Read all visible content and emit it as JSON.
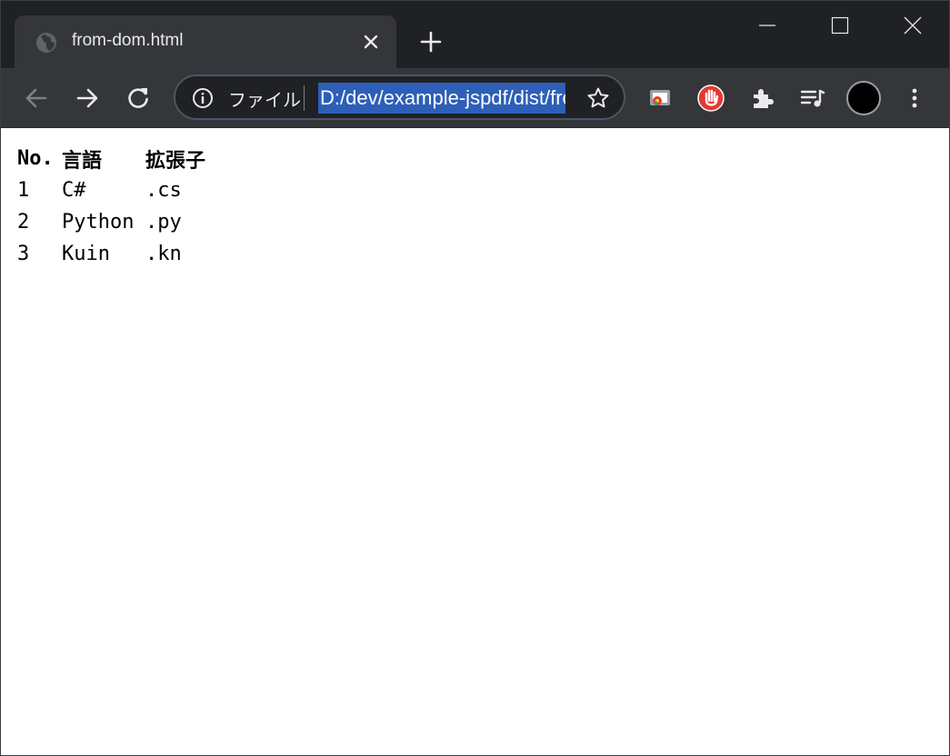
{
  "tab": {
    "title": "from-dom.html"
  },
  "omnibox": {
    "scheme_label": "ファイル",
    "url": "D:/dev/example-jspdf/dist/from-dom.html"
  },
  "table": {
    "headers": [
      "No.",
      "言語",
      "拡張子"
    ],
    "rows": [
      [
        "1",
        "C#",
        ".cs"
      ],
      [
        "2",
        "Python",
        ".py"
      ],
      [
        "3",
        "Kuin",
        ".kn"
      ]
    ]
  },
  "colors": {
    "titlebar": "#202124",
    "toolbar": "#35363a",
    "selection": "#2d5fb8"
  },
  "icons": {
    "favicon": "globe-icon",
    "tab_close": "close-icon",
    "new_tab": "plus-icon",
    "back": "arrow-left-icon",
    "forward": "arrow-right-icon",
    "reload": "reload-icon",
    "info": "info-icon",
    "bookmark": "star-icon",
    "cast": "cast-icon",
    "adblock": "stop-hand-icon",
    "extensions": "puzzle-icon",
    "media": "media-queue-icon",
    "profile": "avatar",
    "menu": "kebab-menu-icon"
  }
}
